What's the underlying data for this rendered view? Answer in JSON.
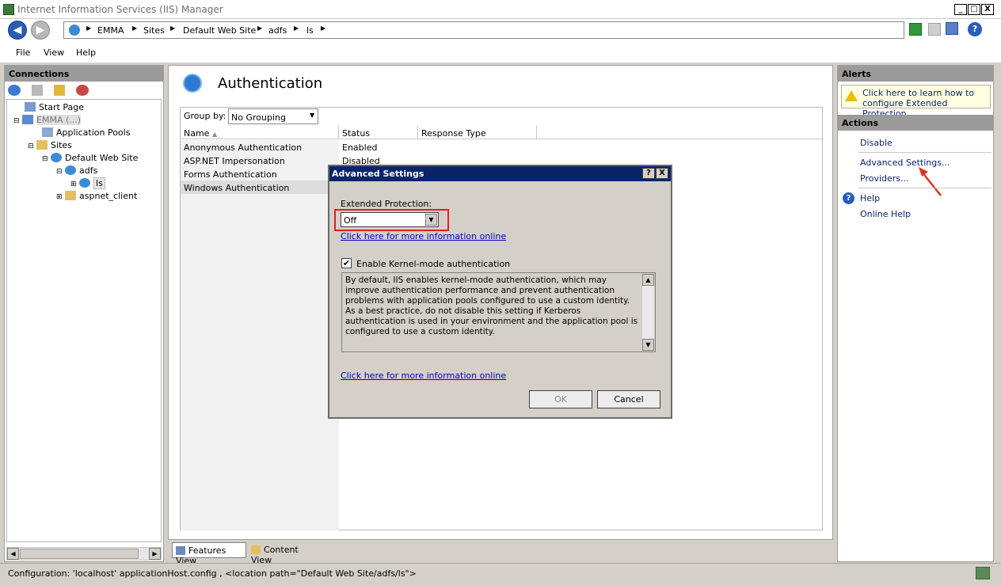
{
  "window": {
    "title": "Internet Information Services (IIS) Manager",
    "min": "_",
    "max": "□",
    "close": "X"
  },
  "address": {
    "crumbs": [
      "EMMA",
      "Sites",
      "Default Web Site",
      "adfs",
      "ls"
    ]
  },
  "menu": {
    "file": "File",
    "view": "View",
    "help": "Help"
  },
  "connections": {
    "header": "Connections",
    "tree": {
      "start": "Start Page",
      "server": "EMMA (...)",
      "app_pools": "Application Pools",
      "sites": "Sites",
      "default_site": "Default Web Site",
      "adfs": "adfs",
      "ls": "ls",
      "aspnet": "aspnet_client"
    }
  },
  "center": {
    "title": "Authentication",
    "group_by_label": "Group by:",
    "group_by_value": "No Grouping",
    "columns": {
      "name": "Name",
      "status": "Status",
      "response": "Response Type"
    },
    "rows": [
      {
        "name": "Anonymous Authentication",
        "status": "Enabled"
      },
      {
        "name": "ASP.NET Impersonation",
        "status": "Disabled"
      },
      {
        "name": "Forms Authentication",
        "status": ""
      },
      {
        "name": "Windows Authentication",
        "status": ""
      }
    ],
    "tabs": {
      "features": "Features View",
      "content": "Content View"
    }
  },
  "right": {
    "alerts_header": "Alerts",
    "alert_text": "Click here to learn how to configure Extended Protection.",
    "actions_header": "Actions",
    "disable": "Disable",
    "advanced": "Advanced Settings...",
    "providers": "Providers...",
    "help": "Help",
    "online_help": "Online Help"
  },
  "dialog": {
    "title": "Advanced Settings",
    "help_btn": "?",
    "close_btn": "X",
    "ep_label": "Extended Protection:",
    "ep_value": "Off",
    "link1": "Click here for more information online",
    "kernel_label": "Enable Kernel-mode authentication",
    "kernel_checked": true,
    "description": "By default, IIS enables kernel-mode authentication, which may improve authentication performance and prevent authentication problems with application pools configured to use a custom identity. As a best practice, do not disable this setting if Kerberos authentication is used in your environment and the application pool is configured to use a custom identity.",
    "link2": "Click here for more information online",
    "ok": "OK",
    "cancel": "Cancel"
  },
  "status": {
    "text": "Configuration: 'localhost' applicationHost.config , <location path=\"Default Web Site/adfs/ls\">"
  },
  "colors": {
    "title_blue": "#0a246a",
    "highlight_red": "#e02020",
    "link": "#0000cc"
  }
}
